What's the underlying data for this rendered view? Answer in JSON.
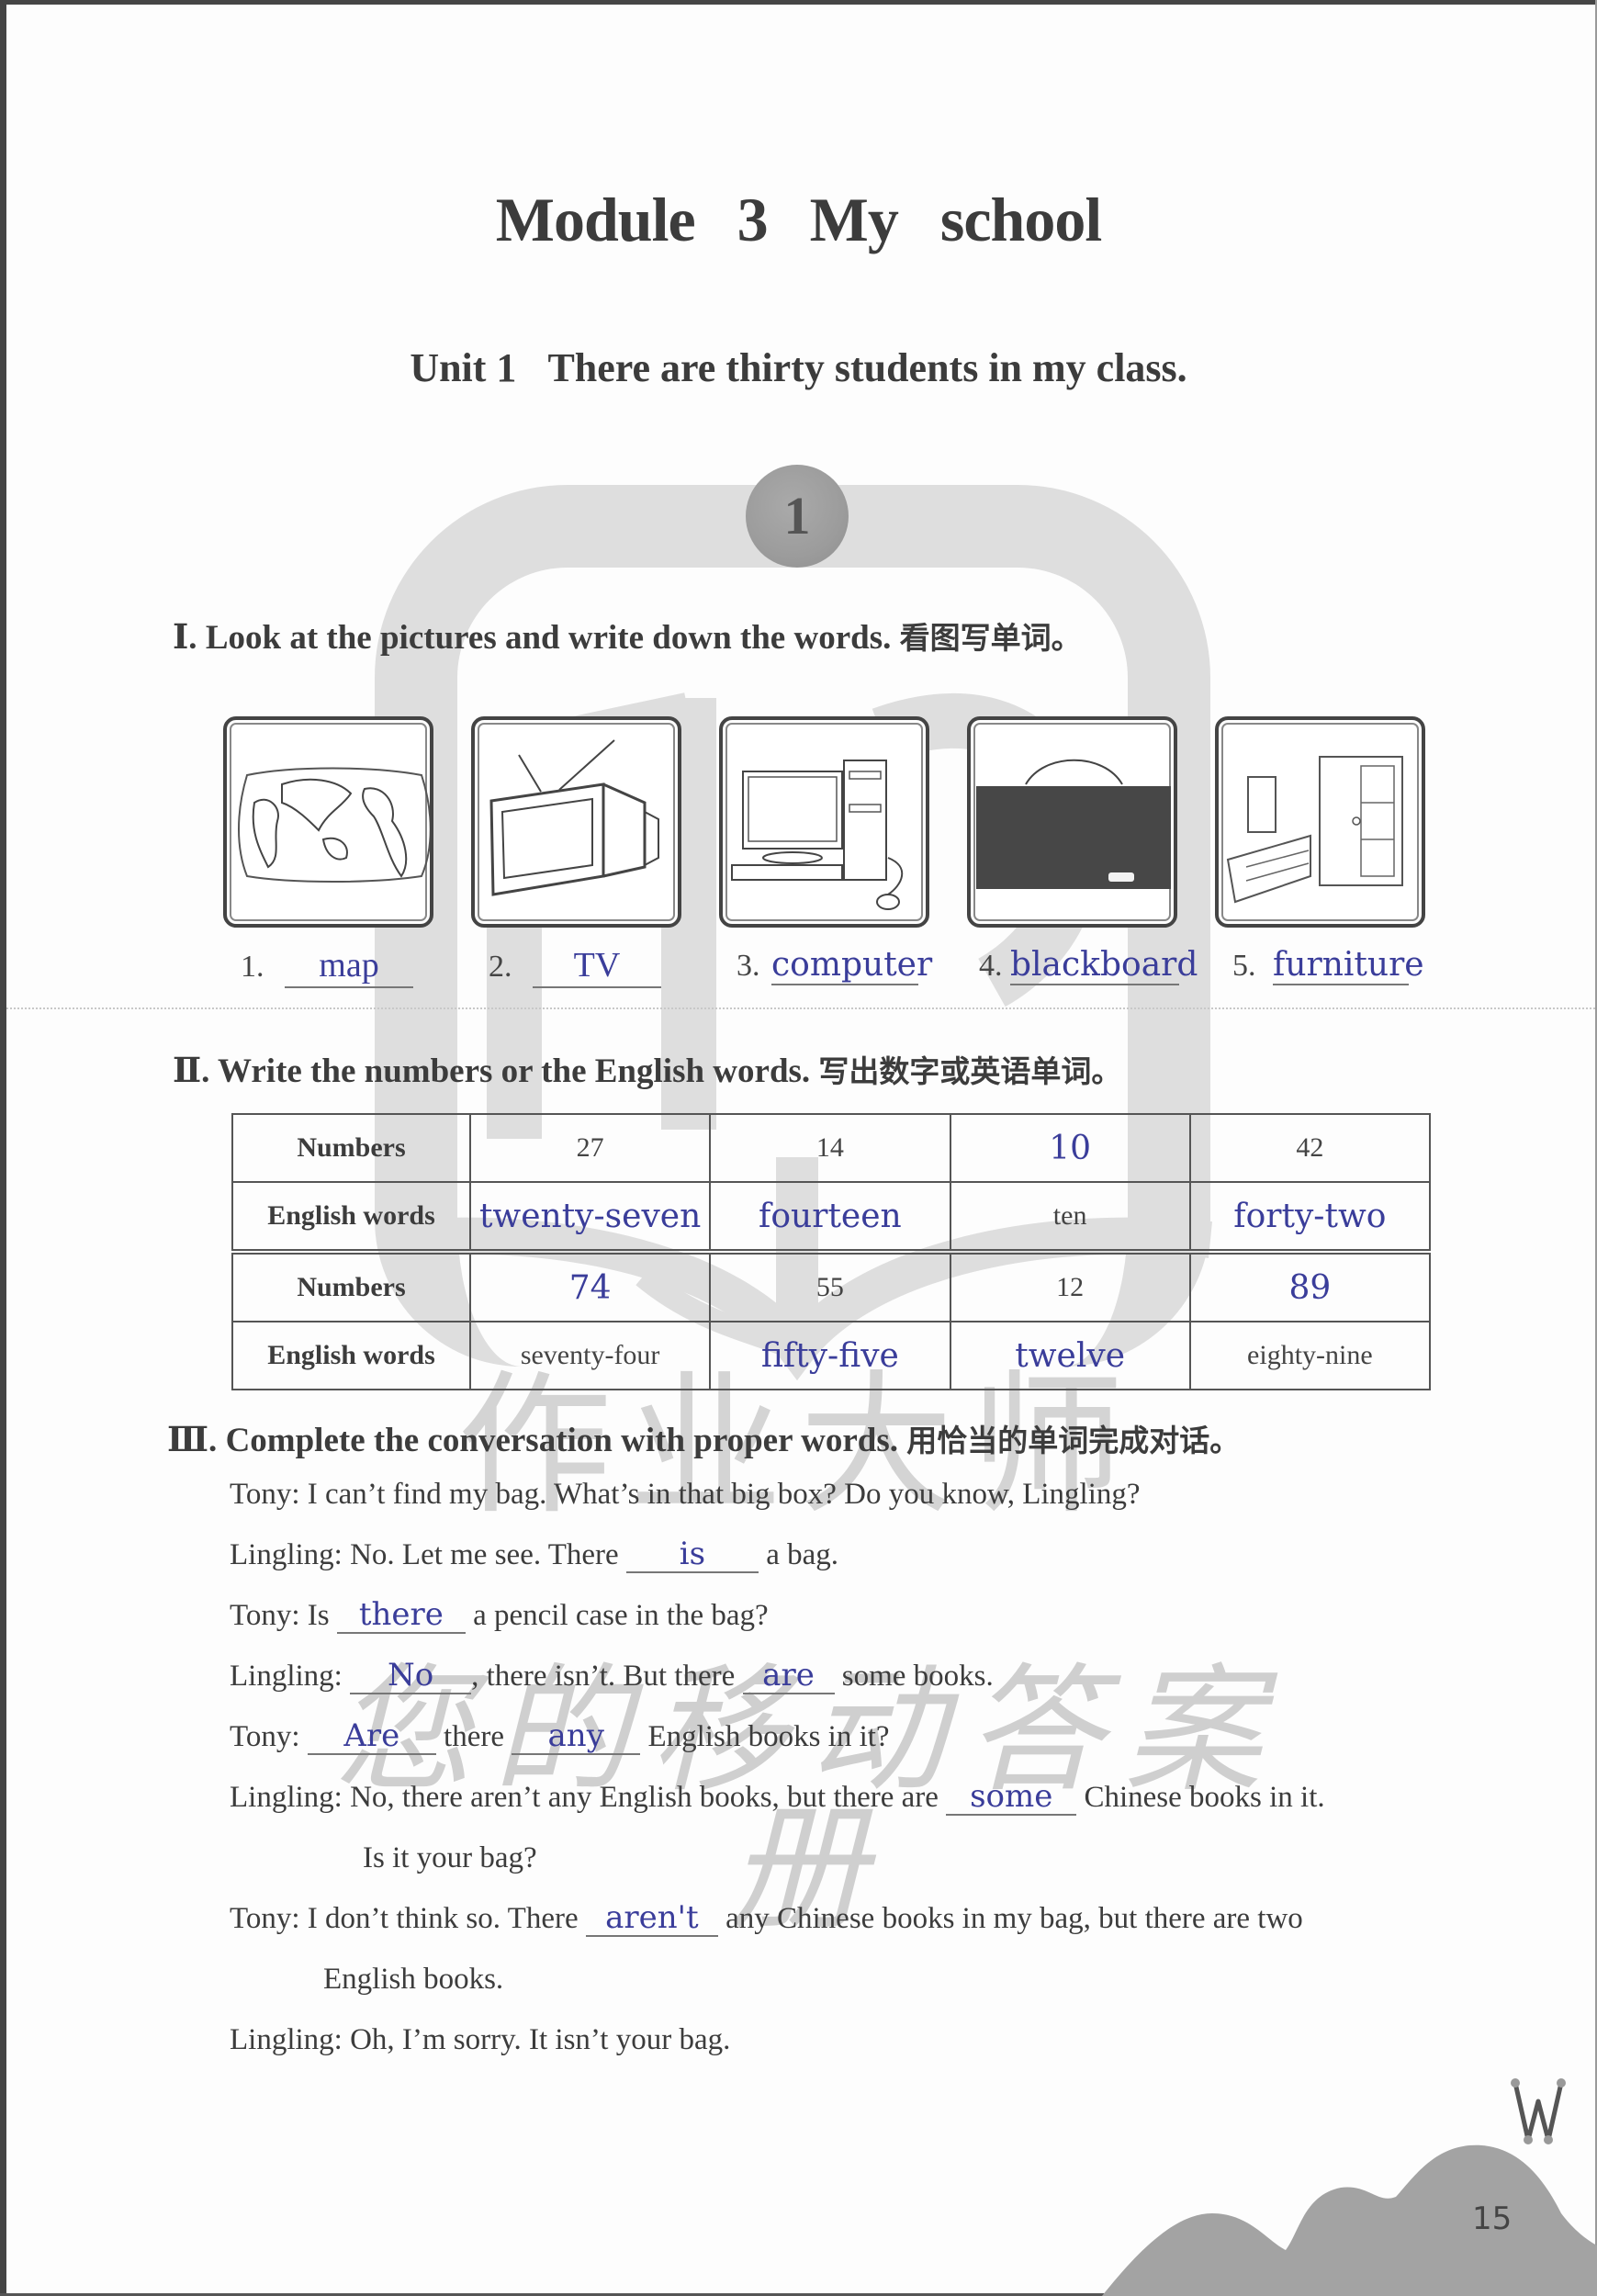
{
  "page": {
    "title": "Module 3    My school",
    "unit_label": "Unit 1",
    "unit_title": "There are thirty students in my class.",
    "badge_number": "1",
    "page_number": "15",
    "corner_letter": "W"
  },
  "watermark": {
    "line1": "作业大师",
    "line2": "您的移动答案册"
  },
  "section1": {
    "numeral": "Ⅰ.",
    "heading": "Look at the pictures and write down the words.",
    "heading_cn": "看图写单词。",
    "items": [
      {
        "num": "1.",
        "picture": "world-map",
        "answer": "map"
      },
      {
        "num": "2.",
        "picture": "television",
        "answer": "TV"
      },
      {
        "num": "3.",
        "picture": "desktop-computer",
        "answer": "computer"
      },
      {
        "num": "4.",
        "picture": "blackboard",
        "answer": "blackboard"
      },
      {
        "num": "5.",
        "picture": "bedroom-furniture",
        "answer": "furniture"
      }
    ]
  },
  "section2": {
    "numeral": "Ⅱ.",
    "heading": "Write the numbers or the English words.",
    "heading_cn": "写出数字或英语单词。",
    "row_headers": {
      "numbers": "Numbers",
      "words": "English words"
    },
    "blocks": [
      {
        "numbers": [
          {
            "value": "27",
            "answer": false
          },
          {
            "value": "14",
            "answer": false
          },
          {
            "value": "10",
            "answer": true
          },
          {
            "value": "42",
            "answer": false
          }
        ],
        "words": [
          {
            "value": "twenty-seven",
            "answer": true
          },
          {
            "value": "fourteen",
            "answer": true
          },
          {
            "value": "ten",
            "answer": false
          },
          {
            "value": "forty-two",
            "answer": true
          }
        ]
      },
      {
        "numbers": [
          {
            "value": "74",
            "answer": true
          },
          {
            "value": "55",
            "answer": false
          },
          {
            "value": "12",
            "answer": false
          },
          {
            "value": "89",
            "answer": true
          }
        ],
        "words": [
          {
            "value": "seventy-four",
            "answer": false
          },
          {
            "value": "fifty-five",
            "answer": true
          },
          {
            "value": "twelve",
            "answer": true
          },
          {
            "value": "eighty-nine",
            "answer": false
          }
        ]
      }
    ]
  },
  "section3": {
    "numeral": "Ⅲ.",
    "heading": "Complete the conversation with proper words.",
    "heading_cn": "用恰当的单词完成对话。",
    "lines": [
      {
        "segments": [
          "Tony: I can’t find my bag. What’s in that big box? Do you know, Lingling?"
        ]
      },
      {
        "segments": [
          "Lingling: No. Let me see. There ",
          {
            "blank": "is"
          },
          " a bag."
        ]
      },
      {
        "segments": [
          "Tony: Is ",
          {
            "blank": "there"
          },
          " a pencil case in the bag?"
        ]
      },
      {
        "segments": [
          "Lingling: ",
          {
            "blank": "No"
          },
          ", there isn’t. But there ",
          {
            "blank": "are"
          },
          " some books."
        ]
      },
      {
        "segments": [
          "Tony: ",
          {
            "blank": "Are"
          },
          " there ",
          {
            "blank": "any"
          },
          " English books in it?"
        ]
      },
      {
        "segments": [
          "Lingling: No, there aren’t any English books, but there are ",
          {
            "blank": "some"
          },
          " Chinese books in it."
        ]
      },
      {
        "segments": [
          "Is it your bag?"
        ],
        "indent": true
      },
      {
        "segments": [
          "Tony: I don’t think so. There ",
          {
            "blank": "aren't"
          },
          " any Chinese books in my bag, but there are two"
        ]
      },
      {
        "segments": [
          "English books."
        ],
        "indent": true
      },
      {
        "segments": [
          "Lingling: Oh, I’m sorry. It isn’t your bag."
        ]
      }
    ]
  },
  "colors": {
    "answer_ink": "#3a3d9a",
    "print_ink": "#3c3c3c",
    "watermark": "#dedede"
  }
}
